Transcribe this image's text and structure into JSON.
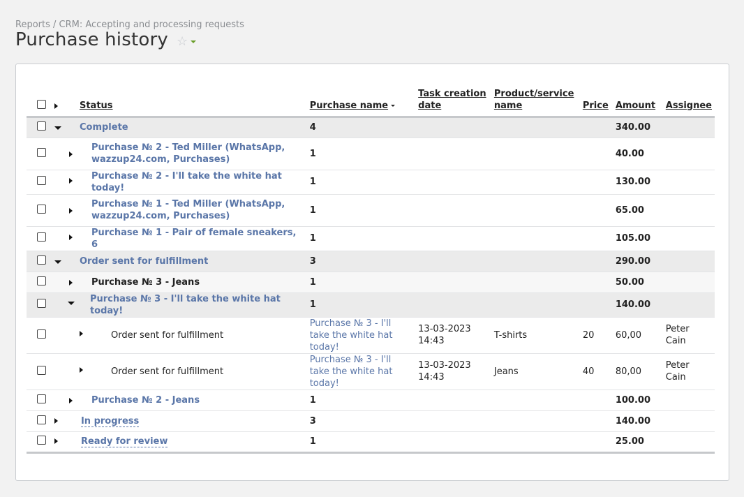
{
  "breadcrumb": "Reports / CRM: Accepting and processing requests",
  "page_title": "Purchase history",
  "columns": {
    "status": "Status",
    "purchase_name": "Purchase name",
    "task_creation_date": "Task creation date",
    "product_service_name": "Product/service name",
    "price": "Price",
    "amount": "Amount",
    "assignee": "Assignee"
  },
  "rows": [
    {
      "status": "Complete",
      "count": "4",
      "amount": "340.00"
    },
    {
      "status": "Purchase № 2 - Ted Miller (WhatsApp, wazzup24.com, Purchases)",
      "count": "1",
      "amount": "40.00"
    },
    {
      "status": "Purchase № 2 - I'll take the white hat today!",
      "count": "1",
      "amount": "130.00"
    },
    {
      "status": "Purchase № 1 - Ted Miller (WhatsApp, wazzup24.com, Purchases)",
      "count": "1",
      "amount": "65.00"
    },
    {
      "status": "Purchase № 1 - Pair of female sneakers, 6",
      "count": "1",
      "amount": "105.00"
    },
    {
      "status": "Order sent for fulfillment",
      "count": "3",
      "amount": "290.00"
    },
    {
      "status": "Purchase № 3 - Jeans",
      "count": "1",
      "amount": "50.00"
    },
    {
      "status": "Purchase № 3 - I'll take the white hat today!",
      "count": "1",
      "amount": "140.00"
    },
    {
      "status": "Order sent for fulfillment",
      "purchase": "Purchase № 3 - I'll take the white hat today!",
      "date": "13-03-2023 14:43",
      "product": "T-shirts",
      "price": "20",
      "amount": "60,00",
      "assignee": "Peter Cain"
    },
    {
      "status": "Order sent for fulfillment",
      "purchase": "Purchase № 3 - I'll take the white hat today!",
      "date": "13-03-2023 14:43",
      "product": "Jeans",
      "price": "40",
      "amount": "80,00",
      "assignee": "Peter Cain"
    },
    {
      "status": "Purchase № 2 - Jeans",
      "count": "1",
      "amount": "100.00"
    },
    {
      "status": "In progress",
      "count": "3",
      "amount": "140.00"
    },
    {
      "status": "Ready for review",
      "count": "1",
      "amount": "25.00"
    }
  ]
}
